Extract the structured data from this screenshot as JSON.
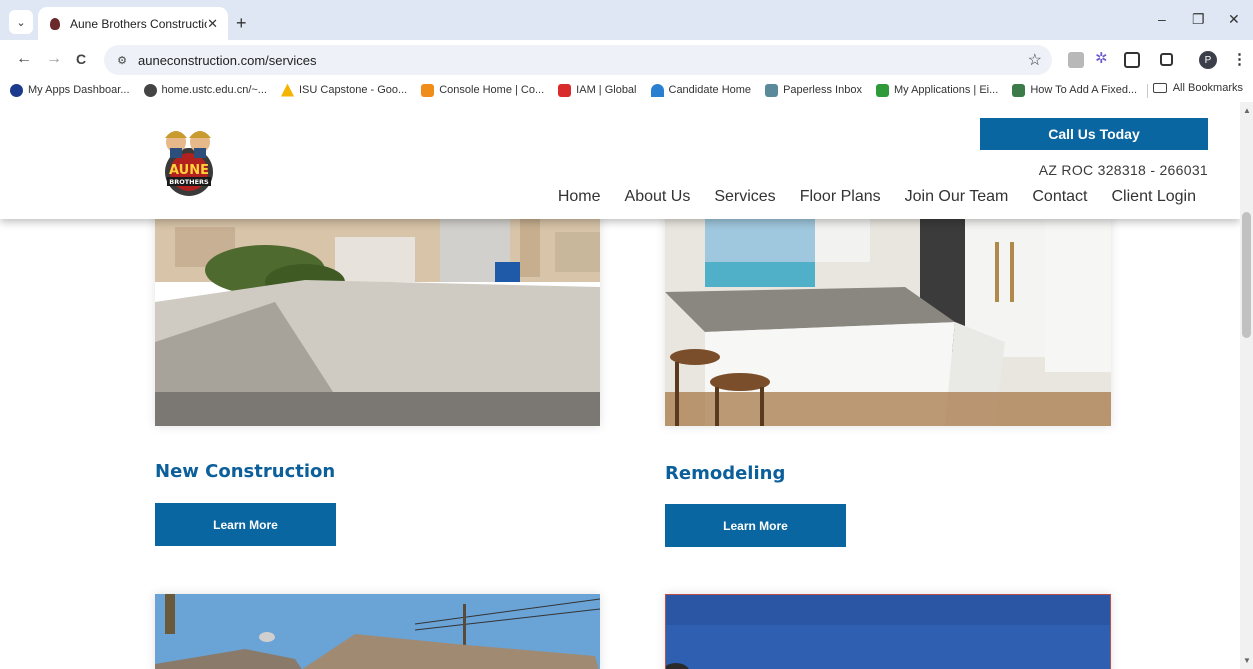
{
  "browser": {
    "tab_title": "Aune Brothers Construction",
    "tab_close": "✕",
    "new_tab": "+",
    "url": "auneconstruction.com/services",
    "profile_initial": "P",
    "window_controls": [
      "–",
      "❐",
      "✕"
    ],
    "nav": {
      "back": "←",
      "forward": "→",
      "reload": "C"
    }
  },
  "bookmarks": [
    {
      "label": "My Apps Dashboar...",
      "color": "#1b3a8c",
      "icon": "circle-icon"
    },
    {
      "label": "home.ustc.edu.cn/~...",
      "color": "#444444",
      "icon": "globe-icon"
    },
    {
      "label": "ISU Capstone - Goo...",
      "color": "#f4b400",
      "icon": "drive-icon"
    },
    {
      "label": "Console Home | Co...",
      "color": "#f08c1a",
      "icon": "aws-icon"
    },
    {
      "label": "IAM | Global",
      "color": "#d92b2b",
      "icon": "iam-icon"
    },
    {
      "label": "Candidate Home",
      "color": "#2a7fd1",
      "icon": "workday-icon"
    },
    {
      "label": "Paperless Inbox",
      "color": "#5a8a9a",
      "icon": "paperless-icon"
    },
    {
      "label": "My Applications | Ei...",
      "color": "#2e9a3a",
      "icon": "green-app-icon"
    },
    {
      "label": "How To Add A Fixed...",
      "color": "#3d7a4a",
      "icon": "fixed-icon"
    }
  ],
  "all_bookmarks": "All Bookmarks",
  "site": {
    "call_button": "Call Us Today",
    "license": "AZ ROC 328318 - 266031",
    "nav": [
      "Home",
      "About Us",
      "Services",
      "Floor Plans",
      "Join Our Team",
      "Contact",
      "Client Login"
    ],
    "logo_text": [
      "AUNE",
      "BROTHERS"
    ]
  },
  "services": [
    {
      "title": "New Construction",
      "button": "Learn More"
    },
    {
      "title": "Remodeling",
      "button": "Learn More"
    }
  ],
  "colors": {
    "brand_blue": "#0a66a0",
    "title_blue": "#0b5f9a"
  }
}
